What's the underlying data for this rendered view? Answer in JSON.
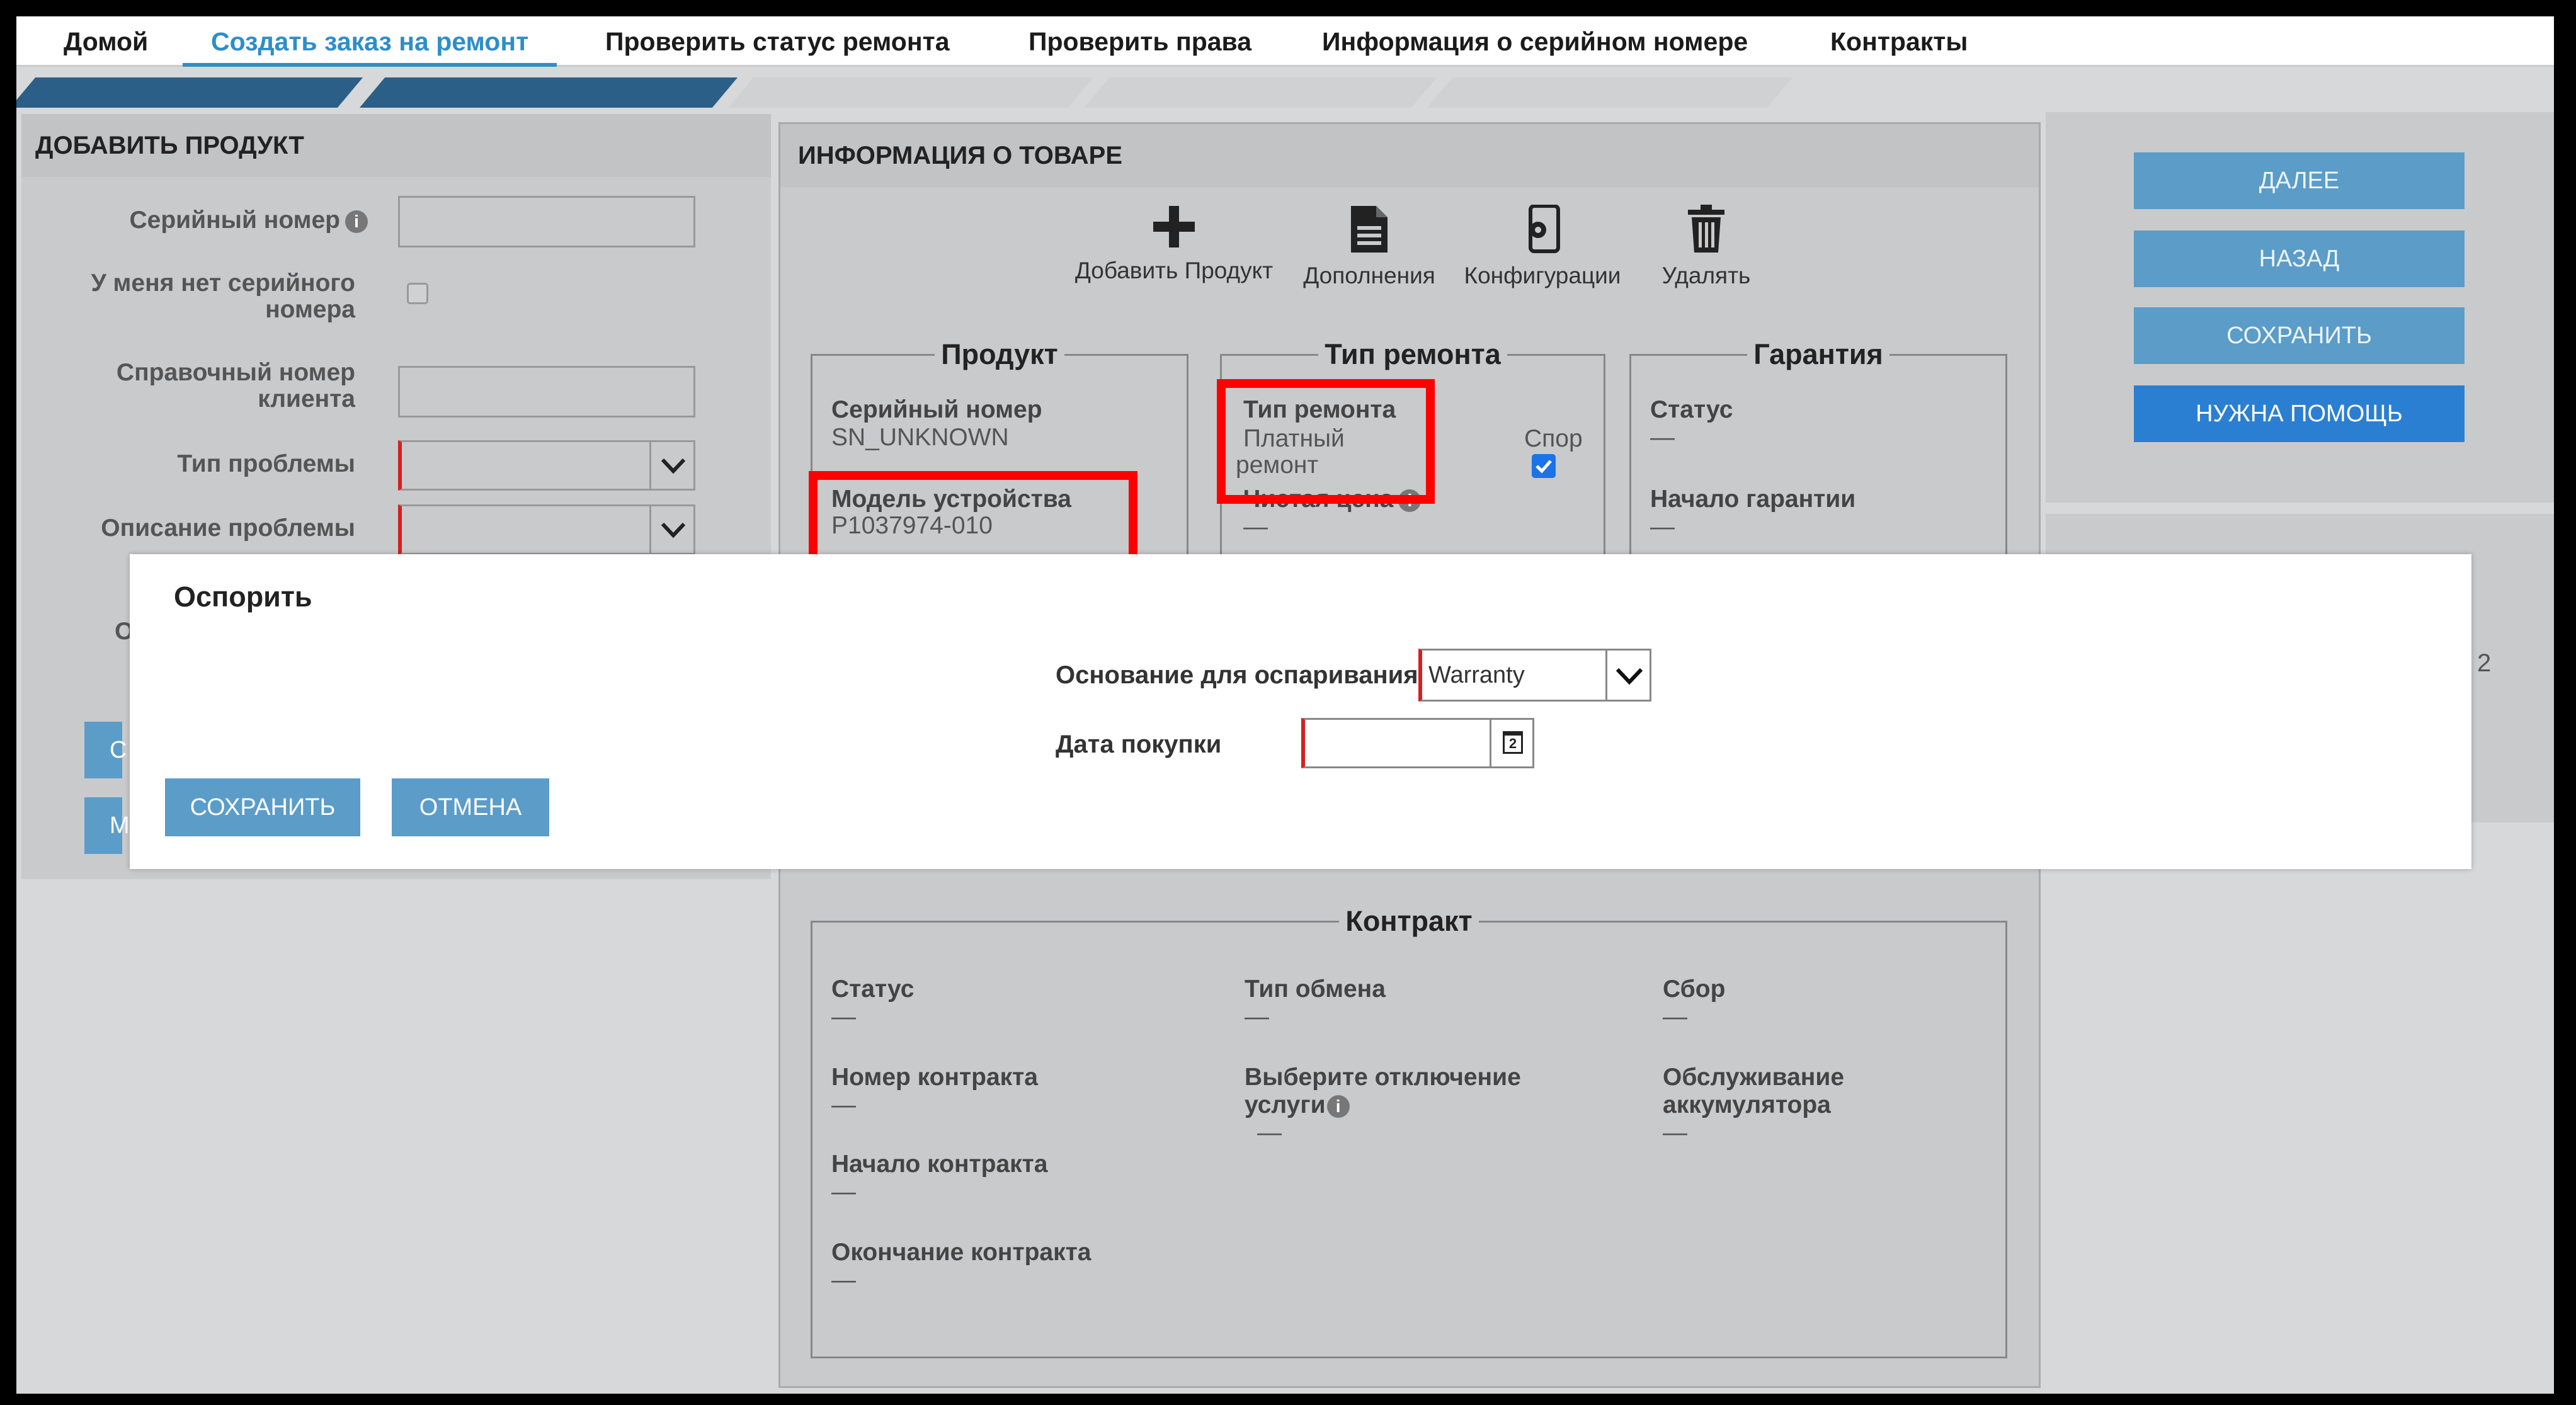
{
  "nav": {
    "items": [
      "Домой",
      "Создать заказ на ремонт",
      "Проверить статус ремонта",
      "Проверить права",
      "Информация о серийном номере",
      "Контракты"
    ],
    "active_index": 1
  },
  "left_panel": {
    "title": "ДОБАВИТЬ ПРОДУКТ",
    "serial_label": "Серийный номер",
    "no_serial_label_1": "У меня нет серийного",
    "no_serial_label_2": "номера",
    "ref_label_1": "Справочный номер",
    "ref_label_2": "клиента",
    "problem_type_label": "Тип проблемы",
    "problem_desc_label": "Описание проблемы"
  },
  "center_panel": {
    "title": "ИНФОРМАЦИЯ О ТОВАРЕ",
    "toolbar": [
      {
        "label": "Добавить Продукт",
        "icon": "plus-icon"
      },
      {
        "label": "Дополнения",
        "icon": "document-icon"
      },
      {
        "label": "Конфигурации",
        "icon": "device-settings-icon"
      },
      {
        "label": "Удалять",
        "icon": "trash-icon"
      }
    ],
    "product": {
      "legend": "Продукт",
      "serial_label": "Серийный номер",
      "serial_value": "SN_UNKNOWN",
      "model_label": "Модель устройства",
      "model_value": "P1037974-010"
    },
    "repair_type": {
      "legend": "Тип ремонта",
      "label": "Тип ремонта",
      "value_1": "Платный",
      "value_2": "ремонт",
      "dispute_label": "Спор",
      "dispute_checked": true,
      "net_price_label": "Чистая цена",
      "net_price_value": "—"
    },
    "warranty": {
      "legend": "Гарантия",
      "status_label": "Статус",
      "status_value": "—",
      "start_label": "Начало гарантии",
      "start_value": "—"
    },
    "contract": {
      "legend": "Контракт",
      "status_label": "Статус",
      "status_value": "—",
      "number_label": "Номер контракта",
      "number_value": "—",
      "start_label": "Начало контракта",
      "start_value": "—",
      "end_label": "Окончание контракта",
      "end_value": "—",
      "exchange_label": "Тип обмена",
      "exchange_value": "—",
      "service_label_1": "Выберите отключение",
      "service_label_2": "услуги",
      "service_value": "—",
      "fee_label": "Сбор",
      "fee_value": "—",
      "battery_label_1": "Обслуживание",
      "battery_label_2": "аккумулятора",
      "battery_value": "—"
    }
  },
  "right_panel": {
    "next": "ДАЛЕЕ",
    "back": "НАЗАД",
    "save": "СОХРАНИТЬ",
    "help": "НУЖНА ПОМОЩЬ",
    "partial_right_char": "2"
  },
  "modal": {
    "title": "Оспорить",
    "reason_label": "Основание для оспаривания",
    "reason_value": "Warranty",
    "date_label": "Дата покупки",
    "date_value": "",
    "calendar_icon_text": "2",
    "save": "СОХРАНИТЬ",
    "cancel": "ОТМЕНА"
  },
  "behind_modal": {
    "left_partial_1": "О",
    "left_btn_partial_1": "С",
    "left_btn_partial_2": "М"
  },
  "colors": {
    "accent": "#2e8ec7",
    "button": "#5b9cc8",
    "primary_button": "#2b7fd2",
    "required": "#d42020",
    "highlight": "#ff0000",
    "overlay_bg": "#d7d8da"
  }
}
